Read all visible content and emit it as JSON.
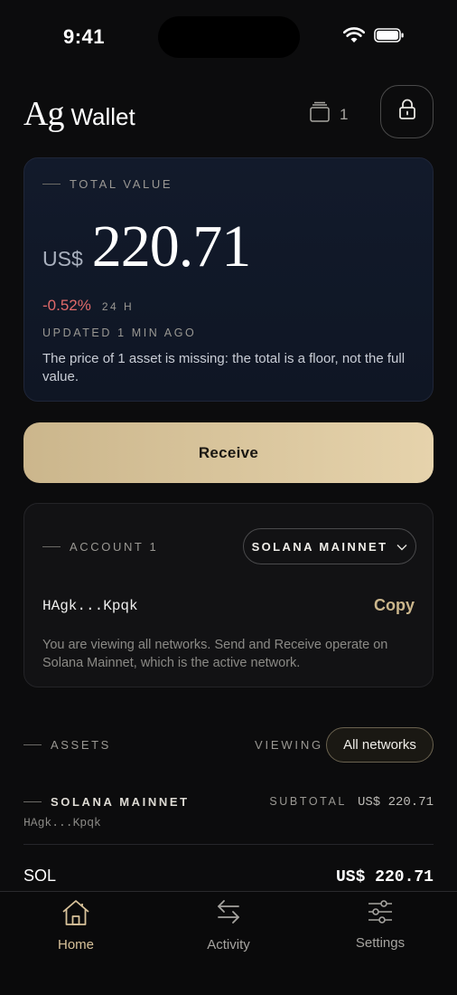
{
  "status_bar": {
    "time": "9:41",
    "icons": [
      "wifi-icon",
      "battery-icon"
    ]
  },
  "header": {
    "brand_mark": "Ag",
    "brand_name": "Wallet",
    "account_count": "1",
    "icons": [
      "accounts-stack-icon",
      "lock-icon"
    ]
  },
  "total_value": {
    "label": "TOTAL VALUE",
    "currency": "US$",
    "amount": "220.71",
    "change_pct": "-0.52%",
    "change_period": "24 H",
    "updated": "UPDATED 1 MIN AGO",
    "note": "The price of 1 asset is missing: the total is a floor, not the full value."
  },
  "receive": {
    "label": "Receive"
  },
  "account": {
    "label": "ACCOUNT 1",
    "network": "SOLANA MAINNET",
    "address": "HAgk...Kpqk",
    "copy_label": "Copy",
    "note": "You are viewing all networks. Send and Receive operate on Solana Mainnet, which is the active network."
  },
  "assets": {
    "label": "ASSETS",
    "viewing_label": "VIEWING",
    "filter": "All networks",
    "group": {
      "network": "SOLANA MAINNET",
      "subtotal_label": "SUBTOTAL",
      "subtotal_value": "US$ 220.71",
      "address": "HAgk...Kpqk"
    },
    "rows": [
      {
        "symbol": "SOL",
        "value": "US$ 220.71"
      }
    ]
  },
  "tabbar": {
    "items": [
      {
        "label": "Home",
        "icon": "home-icon",
        "active": true
      },
      {
        "label": "Activity",
        "icon": "swap-arrows-icon",
        "active": false
      },
      {
        "label": "Settings",
        "icon": "sliders-icon",
        "active": false
      }
    ]
  },
  "colors": {
    "accent": "#cbb68c",
    "negative": "#e06a6a",
    "background": "#0c0c0d"
  }
}
